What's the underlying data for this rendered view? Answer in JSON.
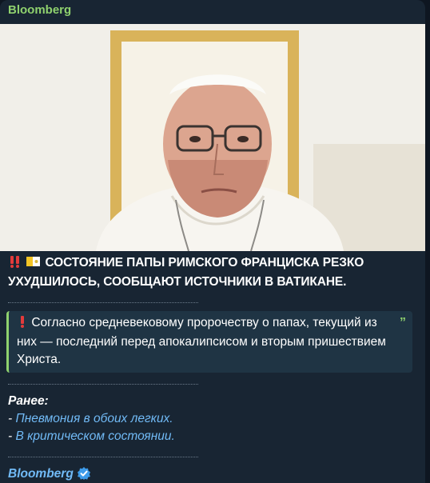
{
  "message": {
    "channel_name": "Bloomberg",
    "photo_icon": "photo-image",
    "headline_emojis": [
      "double-exclamation-icon",
      "vatican-flag-icon"
    ],
    "headline": "СОСТОЯНИЕ ПАПЫ РИМСКОГО ФРАНЦИСКА РЕЗКО УХУДШИЛОСЬ, СООБЩАЮТ ИСТОЧНИКИ В ВАТИКАНЕ.",
    "quote_emoji": "red-exclamation-icon",
    "quote": "Согласно средневековому пророчеству о папах, текущий из них — последний перед апокалипсисом и вторым пришествием Христа.",
    "quote_mark": "”",
    "earlier_label": "Ранее:",
    "earlier_items": [
      {
        "prefix": "- ",
        "link": "Пневмония в обоих легких."
      },
      {
        "prefix": "- ",
        "link": "В критическом состоянии."
      }
    ],
    "signature": "Bloomberg",
    "signature_badge": "verified-badge-icon",
    "colors": {
      "accent_green": "#8fd16e",
      "link_blue": "#71baf6",
      "bubble_bg": "#182533"
    }
  }
}
